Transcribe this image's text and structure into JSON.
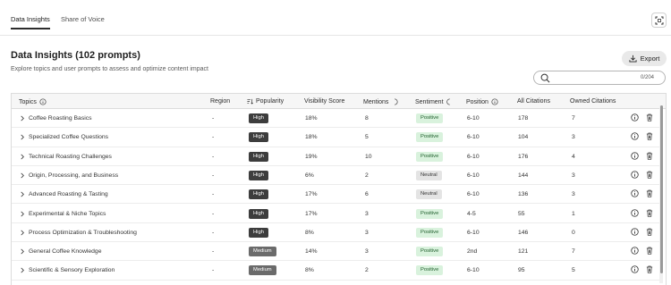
{
  "tabs": [
    {
      "label": "Data Insights",
      "active": true
    },
    {
      "label": "Share of Voice",
      "active": false
    }
  ],
  "header": {
    "title": "Data Insights (102 prompts)",
    "subtitle": "Explore topics and user prompts to assess and optimize content impact",
    "export_label": "Export"
  },
  "search": {
    "value": "",
    "placeholder": "",
    "counter": "0/204"
  },
  "columns": {
    "topics": "Topics",
    "region": "Region",
    "popularity": "Popularity",
    "visibility": "Visibility Score",
    "mentions": "Mentions",
    "sentiment": "Sentiment",
    "position": "Position",
    "citations": "All Citations",
    "owned": "Owned Citations"
  },
  "rows": [
    {
      "topic": "Coffee Roasting Basics",
      "region": "-",
      "popularity": "High",
      "visibility": "18%",
      "mentions": "8",
      "sentiment": "Positive",
      "position": "6-10",
      "citations": "178",
      "owned": "7"
    },
    {
      "topic": "Specialized Coffee Questions",
      "region": "-",
      "popularity": "High",
      "visibility": "18%",
      "mentions": "5",
      "sentiment": "Positive",
      "position": "6-10",
      "citations": "104",
      "owned": "3"
    },
    {
      "topic": "Technical Roasting Challenges",
      "region": "-",
      "popularity": "High",
      "visibility": "19%",
      "mentions": "10",
      "sentiment": "Positive",
      "position": "6-10",
      "citations": "176",
      "owned": "4"
    },
    {
      "topic": "Origin, Processing, and Business",
      "region": "-",
      "popularity": "High",
      "visibility": "6%",
      "mentions": "2",
      "sentiment": "Neutral",
      "position": "6-10",
      "citations": "144",
      "owned": "3"
    },
    {
      "topic": "Advanced Roasting & Tasting",
      "region": "-",
      "popularity": "High",
      "visibility": "17%",
      "mentions": "6",
      "sentiment": "Neutral",
      "position": "6-10",
      "citations": "136",
      "owned": "3"
    },
    {
      "topic": "Experimental & Niche Topics",
      "region": "-",
      "popularity": "High",
      "visibility": "17%",
      "mentions": "3",
      "sentiment": "Positive",
      "position": "4-5",
      "citations": "55",
      "owned": "1"
    },
    {
      "topic": "Process Optimization & Troubleshooting",
      "region": "-",
      "popularity": "High",
      "visibility": "8%",
      "mentions": "3",
      "sentiment": "Positive",
      "position": "6-10",
      "citations": "146",
      "owned": "0"
    },
    {
      "topic": "General Coffee Knowledge",
      "region": "-",
      "popularity": "Medium",
      "visibility": "14%",
      "mentions": "3",
      "sentiment": "Positive",
      "position": "2nd",
      "citations": "121",
      "owned": "7"
    },
    {
      "topic": "Scientific & Sensory Exploration",
      "region": "-",
      "popularity": "Medium",
      "visibility": "8%",
      "mentions": "2",
      "sentiment": "Positive",
      "position": "6-10",
      "citations": "95",
      "owned": "5"
    }
  ],
  "colors": {
    "positive_bg": "#d9f2dd",
    "neutral_bg": "#e4e4e4",
    "high_badge": "#3d3d3d",
    "medium_badge": "#6b6b6b"
  },
  "icons": {
    "fullscreen": "fullscreen-icon",
    "export": "download-icon",
    "search": "search-icon",
    "info": "info-icon",
    "sort": "sort-icon",
    "delete": "trash-icon",
    "expand": "chevron-right-icon"
  }
}
